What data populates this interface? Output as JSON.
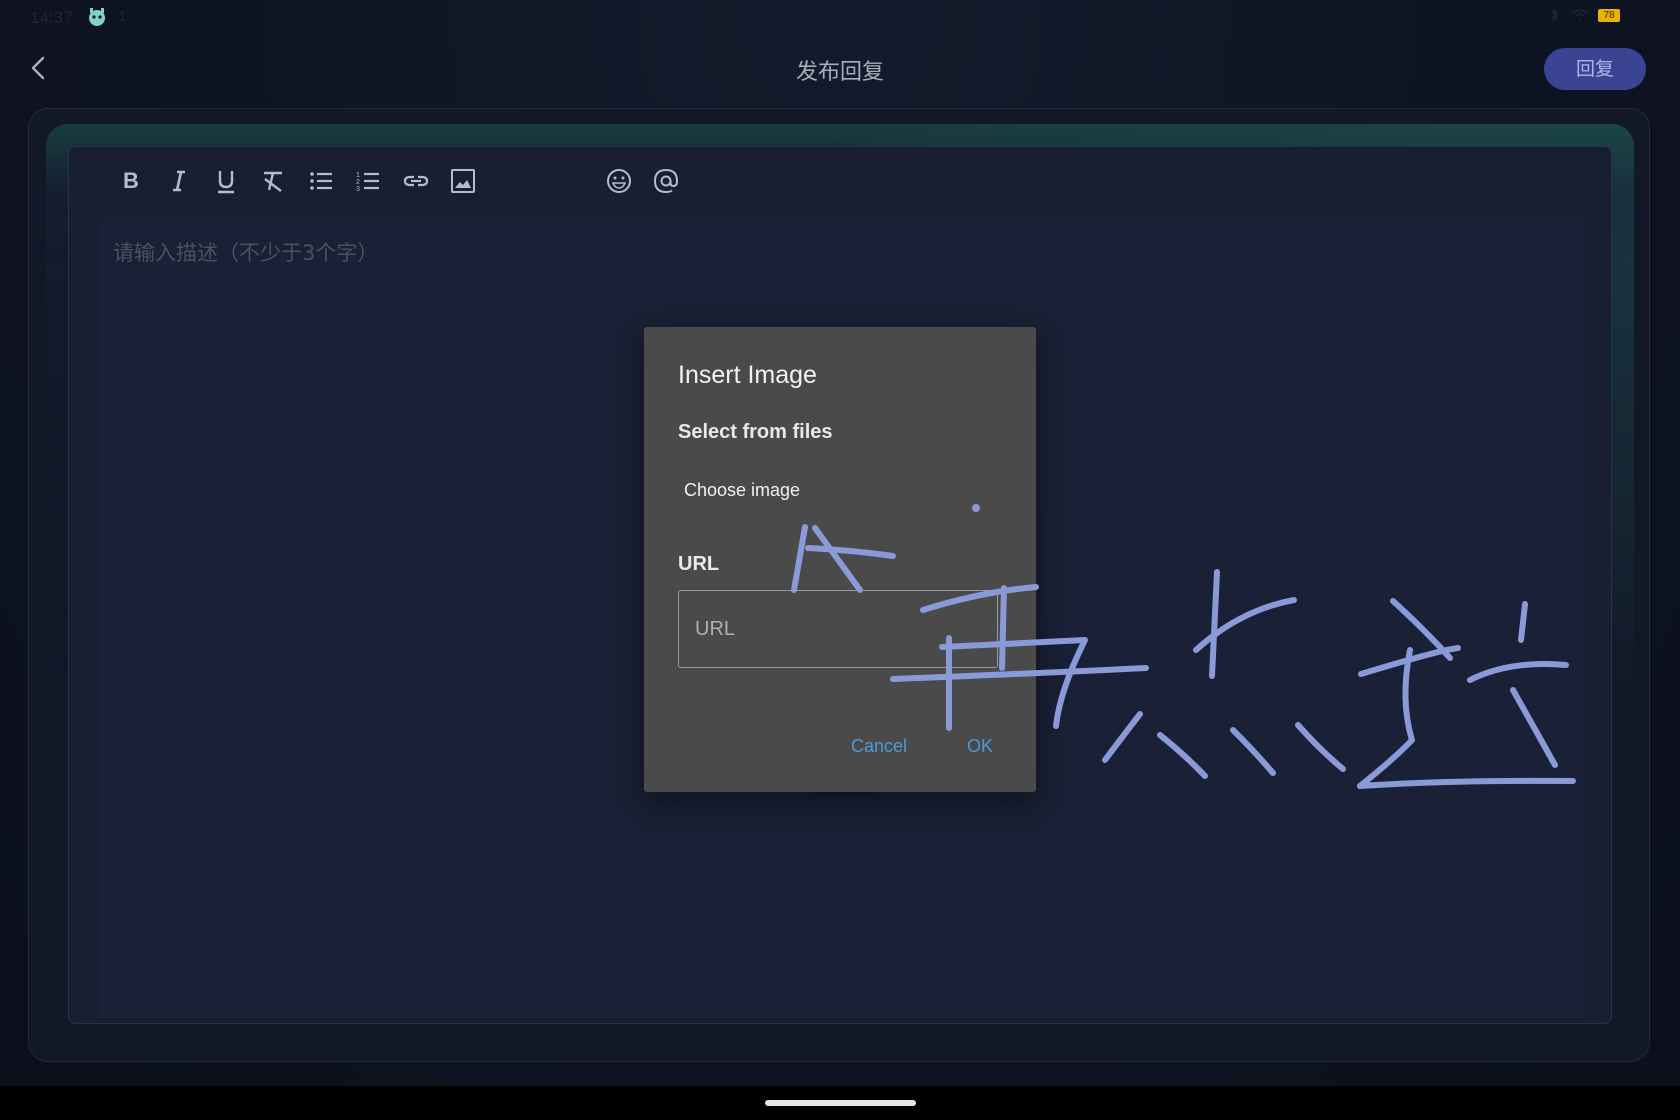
{
  "status_bar": {
    "time": "14:37",
    "extra": "1",
    "battery": "78"
  },
  "header": {
    "title": "发布回复",
    "reply_label": "回复"
  },
  "editor": {
    "placeholder": "请输入描述（不少于3个字）",
    "toolbar": [
      "bold-icon",
      "italic-icon",
      "underline-icon",
      "clear-format-icon",
      "bullet-list-icon",
      "numbered-list-icon",
      "link-icon",
      "image-icon",
      "emoji-icon",
      "mention-icon"
    ]
  },
  "dialog": {
    "title": "Insert Image",
    "section_label": "Select from files",
    "choose_image": "Choose image",
    "url_label": "URL",
    "url_placeholder": "URL",
    "url_value": "",
    "cancel_label": "Cancel",
    "ok_label": "OK"
  },
  "annotation": {
    "color": "#8a9ad8"
  }
}
